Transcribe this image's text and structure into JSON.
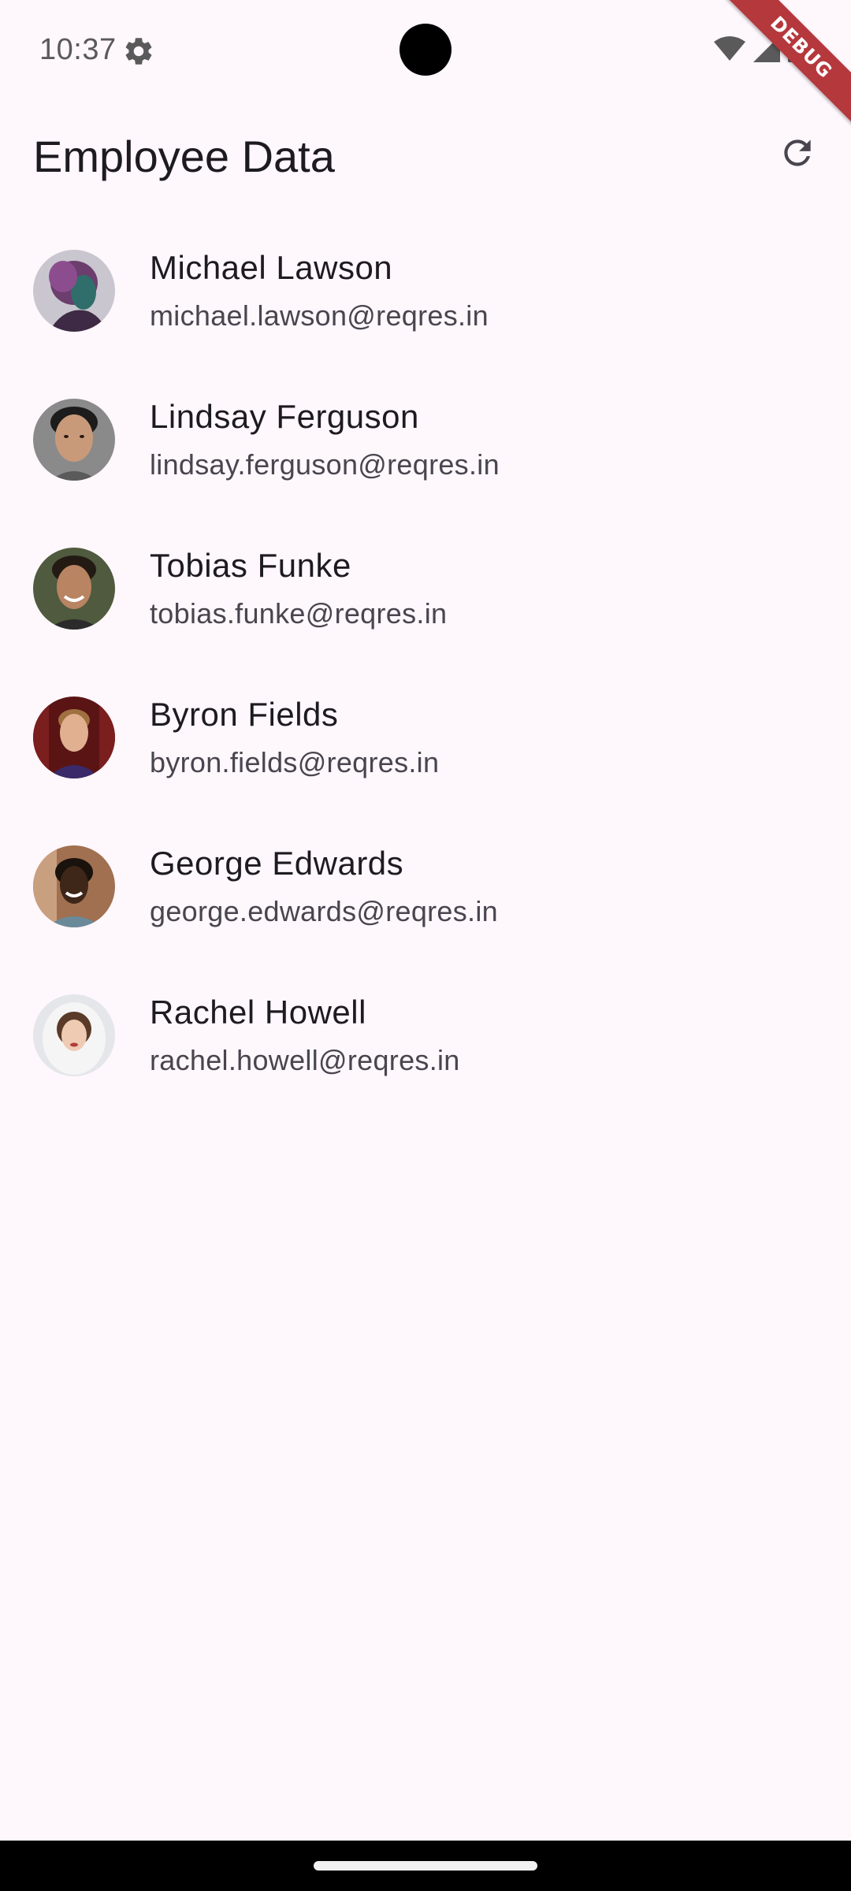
{
  "status_bar": {
    "time": "10:37",
    "icons": [
      "settings-gear-icon",
      "wifi-icon",
      "cellular-signal-icon",
      "battery-icon"
    ]
  },
  "debug_banner": {
    "label": "DEBUG",
    "color": "#b5383d"
  },
  "app_bar": {
    "title": "Employee Data",
    "action_icon": "refresh-icon"
  },
  "employees": [
    {
      "name": "Michael Lawson",
      "email": "michael.lawson@reqres.in"
    },
    {
      "name": "Lindsay Ferguson",
      "email": "lindsay.ferguson@reqres.in"
    },
    {
      "name": "Tobias Funke",
      "email": "tobias.funke@reqres.in"
    },
    {
      "name": "Byron Fields",
      "email": "byron.fields@reqres.in"
    },
    {
      "name": "George Edwards",
      "email": "george.edwards@reqres.in"
    },
    {
      "name": "Rachel Howell",
      "email": "rachel.howell@reqres.in"
    }
  ],
  "colors": {
    "background": "#fef7fc",
    "primary_text": "#1d1b20",
    "secondary_text": "#49454f",
    "nav_bar": "#000000"
  }
}
